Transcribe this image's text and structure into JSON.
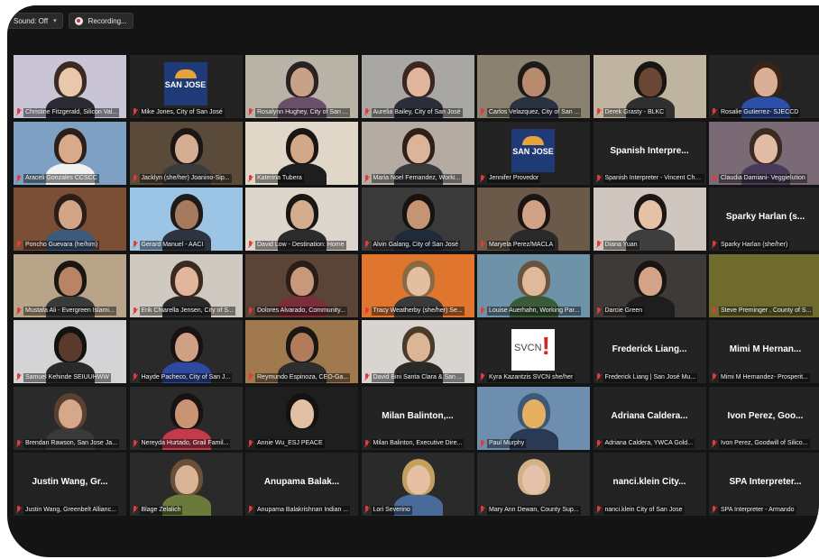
{
  "toolbar": {
    "sound_label": "Sound: Off",
    "recording_label": "Recording..."
  },
  "colors": {
    "frame": "#141414",
    "tile": "#232323",
    "muted_mic": "#e23b3b",
    "active_speaker": "#9ed84b"
  },
  "participants": [
    {
      "name": "Christine Fitzgerald, Silicon Val...",
      "kind": "video",
      "bg": "#c9c4d6",
      "skin": "#e9c7aa",
      "hair": "#3a2a22",
      "shirt": "#2b2b33"
    },
    {
      "name": "Mike Jones, City of San José",
      "kind": "logo-sj",
      "logo_text": "SAN JOSE"
    },
    {
      "name": "Rosalynn Hughey, City of San ...",
      "kind": "video",
      "bg": "#b9b2a6",
      "skin": "#c9a088",
      "hair": "#2a2220",
      "shirt": "#6b4e6a"
    },
    {
      "name": "Aurelia Bailey, City of San José",
      "kind": "video",
      "bg": "#a8a7a4",
      "skin": "#e2b69c",
      "hair": "#3b2620",
      "shirt": "#2a2e3a"
    },
    {
      "name": "Carlos Velazquez, City of San ...",
      "kind": "video",
      "bg": "#8a8170",
      "skin": "#b98a6e",
      "hair": "#1e1a18",
      "shirt": "#2a3140"
    },
    {
      "name": "Derek Grasty - BLKC",
      "kind": "video",
      "bg": "#bfb4a0",
      "skin": "#6a4634",
      "hair": "#1a1412",
      "shirt": "#2f2f2f"
    },
    {
      "name": "Rosalie Gutierrez- SJECCD",
      "kind": "video",
      "bg": "#242424",
      "skin": "#d9b096",
      "hair": "#3a2418",
      "shirt": "#2c4fa8"
    },
    {
      "name": "Araceli Gonzales CCSCC",
      "kind": "video",
      "bg": "#7ea0c2",
      "skin": "#d9a98a",
      "hair": "#2c1e18",
      "shirt": "#f1f1f1"
    },
    {
      "name": "Jacklyn (she/her) Joanino-Sip...",
      "kind": "video",
      "bg": "#5a4a3a",
      "skin": "#d5ad92",
      "hair": "#1c1614",
      "shirt": "#3b3b3b"
    },
    {
      "name": "Katerina Tubera",
      "kind": "video",
      "bg": "#e1d7c8",
      "skin": "#d2a888",
      "hair": "#1a1412",
      "shirt": "#1e1e1e",
      "speaking": true
    },
    {
      "name": "Maria Noel Fernandez, Worki...",
      "kind": "video",
      "bg": "#b4aca2",
      "skin": "#dcb49a",
      "hair": "#2e2018",
      "shirt": "#3a3a3a"
    },
    {
      "name": "Jennifer Provedor",
      "kind": "logo-sj",
      "logo_text": "SAN JOSE"
    },
    {
      "name": "Spanish Interpreter - Vincent Cha...",
      "kind": "name",
      "display": "Spanish Interpre..."
    },
    {
      "name": "Claudia Damiani- Veggielution",
      "kind": "video",
      "bg": "#7a6a76",
      "skin": "#e1bba4",
      "hair": "#3a2a20",
      "shirt": "#4a3a5a"
    },
    {
      "name": "Poncho Guevara (he/him)",
      "kind": "video",
      "bg": "#7b4e36",
      "skin": "#d4a488",
      "hair": "#2a1e18",
      "shirt": "#3c5a7a"
    },
    {
      "name": "Gerard Manuel - AACI",
      "kind": "video",
      "bg": "#9cc4e4",
      "skin": "#a57a5e",
      "hair": "#1e1a18",
      "shirt": "#2e3340"
    },
    {
      "name": "David Low - Destination: Home",
      "kind": "video",
      "bg": "#dcd6cc",
      "skin": "#d4ac8e",
      "hair": "#1a1614",
      "shirt": "#2b2b2b"
    },
    {
      "name": "Alvin Galang, City of San José",
      "kind": "video",
      "bg": "#3a3a3a",
      "skin": "#c49474",
      "hair": "#161412",
      "shirt": "#1f2a3a"
    },
    {
      "name": "Maryela Perez/MACLA",
      "kind": "video",
      "bg": "#6b5a4a",
      "skin": "#d2a286",
      "hair": "#1c1412",
      "shirt": "#2a2a2a"
    },
    {
      "name": "Diana Yuan",
      "kind": "video",
      "bg": "#cfc7bf",
      "skin": "#e4c2a8",
      "hair": "#1e1612",
      "shirt": "#3e3e3e"
    },
    {
      "name": "Sparky Harlan (she/her)",
      "kind": "name",
      "display": "Sparky Harlan (s..."
    },
    {
      "name": "Mustafa Ali - Evergreen Islami...",
      "kind": "video",
      "bg": "#b8a488",
      "skin": "#b88464",
      "hair": "#1a1614",
      "shirt": "#3a3a3a"
    },
    {
      "name": "Erik Chiarella Jensen, City of S...",
      "kind": "video",
      "bg": "#cfc9c2",
      "skin": "#e2b69a",
      "hair": "#3a2a20",
      "shirt": "#2a2a2a"
    },
    {
      "name": "Dolores Alvarado, Community...",
      "kind": "video",
      "bg": "#5a4438",
      "skin": "#c8987a",
      "hair": "#2a1c16",
      "shirt": "#7a2e3a"
    },
    {
      "name": "Tracy Weatherby (she/her) Se...",
      "kind": "video",
      "bg": "#e0762e",
      "skin": "#e4bea0",
      "hair": "#8a6a44",
      "shirt": "#3a3a3a"
    },
    {
      "name": "Louise Auerhahn, Working Par...",
      "kind": "video",
      "bg": "#6e92a8",
      "skin": "#e0b89c",
      "hair": "#6a5440",
      "shirt": "#3a5a3a"
    },
    {
      "name": "Darcie Green",
      "kind": "video",
      "bg": "#3e3a38",
      "skin": "#d4a488",
      "hair": "#1a1412",
      "shirt": "#1e1e1e"
    },
    {
      "name": "Steve Preminger , County of S...",
      "kind": "video",
      "bg": "#6f6a2e",
      "skin": "#6f6a2e",
      "hair": "#6f6a2e",
      "shirt": "#6f6a2e"
    },
    {
      "name": "Samuel Kehinde SEIUUHWW",
      "kind": "video",
      "bg": "#d4d4d6",
      "skin": "#5a3a2a",
      "hair": "#141210",
      "shirt": "#2a2a2a"
    },
    {
      "name": "Hayde Pacheco, City of San J...",
      "kind": "video",
      "bg": "#2a2a2a",
      "skin": "#d0a084",
      "hair": "#1a1210",
      "shirt": "#2d4aa0"
    },
    {
      "name": "Reymundo Espinoza, CEO-Ga...",
      "kind": "video",
      "bg": "#a07a4e",
      "skin": "#b07c5c",
      "hair": "#1a1614",
      "shirt": "#2e2e2e"
    },
    {
      "name": "David Bini Santa Clara & San ...",
      "kind": "video",
      "bg": "#d8d4d0",
      "skin": "#dcb496",
      "hair": "#4a3a2a",
      "shirt": "#2a2a2a"
    },
    {
      "name": "Kyra Kazantzis SVCN she/her",
      "kind": "logo-svcn",
      "logo_text": "SVCN",
      "logo_mark": "!"
    },
    {
      "name": "Frederick Liang | San José Mu...",
      "kind": "name",
      "display": "Frederick Liang..."
    },
    {
      "name": "Mimi M Hernandez- Prosperit...",
      "kind": "name",
      "display": "Mimi M Hernan..."
    },
    {
      "name": "Brendan Rawson, San Jose Ja...",
      "kind": "video",
      "bg": "#2a2a2a",
      "skin": "#d6a88a",
      "hair": "#5a4030",
      "shirt": "#3a3a3a"
    },
    {
      "name": "Nereyda Hurtado, Grail Famil...",
      "kind": "video",
      "bg": "#2a2a2a",
      "skin": "#c89474",
      "hair": "#1a1210",
      "shirt": "#c43a4a"
    },
    {
      "name": "Annie Wu_ESJ PEACE",
      "kind": "video",
      "bg": "#1e1e1e",
      "skin": "#e2c0a4",
      "hair": "#141210",
      "shirt": "#1e1e1e"
    },
    {
      "name": "Milan Balinton, Executive Dire...",
      "kind": "name",
      "display": "Milan Balinton,..."
    },
    {
      "name": "Paul Murphy",
      "kind": "video",
      "bg": "#6e8eb0",
      "skin": "#e6b060",
      "hair": "#3c5a78",
      "shirt": "#2a3a54"
    },
    {
      "name": "Adriana Caldera, YWCA Gold...",
      "kind": "name",
      "display": "Adriana Caldera..."
    },
    {
      "name": "Ivon Perez, Goodwill of Silico...",
      "kind": "name",
      "display": "Ivon Perez, Goo..."
    },
    {
      "name": "Justin Wang, Greenbelt Allianc...",
      "kind": "name",
      "display": "Justin Wang, Gr..."
    },
    {
      "name": "Blage Zelalich",
      "kind": "video",
      "bg": "#2a2a2a",
      "skin": "#dab496",
      "hair": "#6a5038",
      "shirt": "#6a7a3a"
    },
    {
      "name": "Anupama Balakrishnan Indian ...",
      "kind": "name",
      "display": "Anupama Balak..."
    },
    {
      "name": "Lori Severino",
      "kind": "video",
      "bg": "#2a2a2a",
      "skin": "#e6c0a4",
      "hair": "#c4a060",
      "shirt": "#4a6a9a"
    },
    {
      "name": "Mary Ann Dewan, County Sup...",
      "kind": "video",
      "bg": "#2a2a2a",
      "skin": "#e6c2a8",
      "hair": "#d2b088",
      "shirt": "#2a2a2a"
    },
    {
      "name": "nanci.klein City of San Jose",
      "kind": "name",
      "display": "nanci.klein City..."
    },
    {
      "name": "SPA Interpreter - Armando",
      "kind": "name",
      "display": "SPA Interpreter..."
    }
  ]
}
